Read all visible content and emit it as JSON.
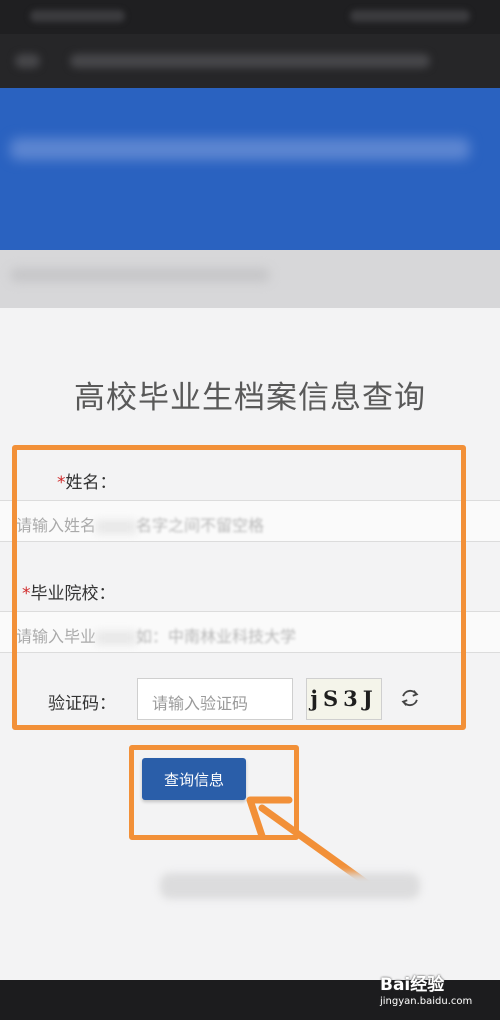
{
  "page": {
    "title": "高校毕业生档案信息查询"
  },
  "form": {
    "name": {
      "required_mark": "*",
      "label": "姓名：",
      "placeholder_visible": "请输入姓名",
      "placeholder_tail": "名字之间不留空格"
    },
    "school": {
      "required_mark": "*",
      "label": "毕业院校：",
      "placeholder_visible": "请输入毕业",
      "placeholder_tail": "如：中南林业科技大学"
    },
    "captcha": {
      "label": "验证码：",
      "placeholder": "请输入验证码",
      "image_text": "jS3J",
      "refresh_icon": "refresh-icon"
    },
    "submit_label": "查询信息"
  },
  "watermark": {
    "brand": "Bai经验",
    "url": "jingyan.baidu.com"
  },
  "colors": {
    "highlight": "#f29038",
    "button": "#2a5ea9",
    "banner": "#2a62c0",
    "required": "#d02a2a"
  }
}
